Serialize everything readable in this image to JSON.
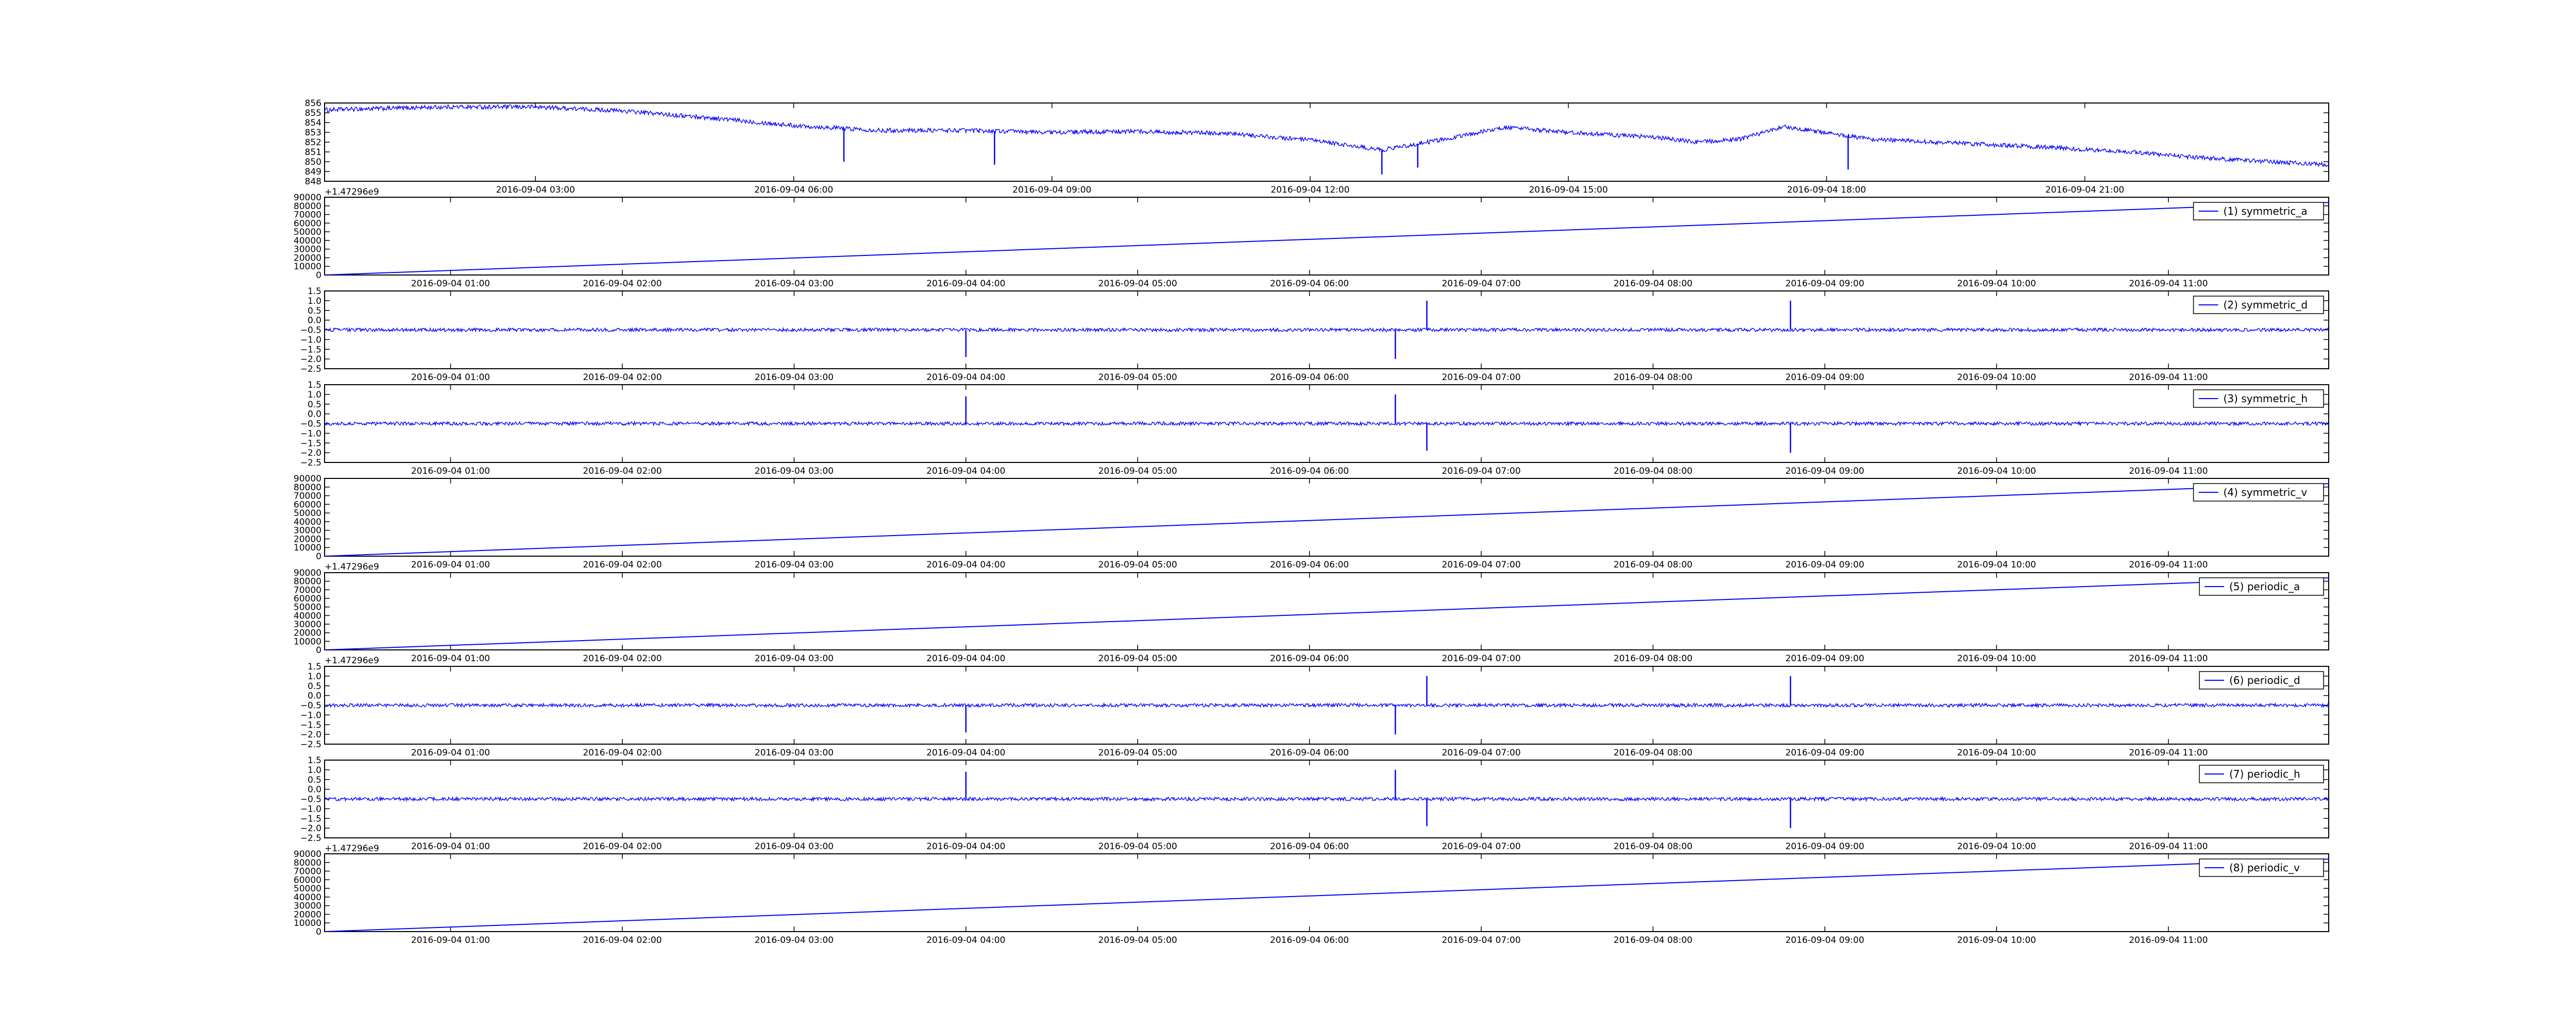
{
  "colors": {
    "line": "#0000ff",
    "axis": "#000000",
    "background": "#ffffff"
  },
  "chart_data": [
    {
      "type": "line",
      "title": "",
      "xlabel": "",
      "ylabel": "",
      "x_scale": "time",
      "xlim": [
        "2016-09-04 00:33",
        "2016-09-04 23:50"
      ],
      "ylim": [
        848,
        856
      ],
      "x_ticks": [
        "2016-09-04 03:00",
        "2016-09-04 06:00",
        "2016-09-04 09:00",
        "2016-09-04 12:00",
        "2016-09-04 15:00",
        "2016-09-04 18:00",
        "2016-09-04 21:00"
      ],
      "y_ticks": [
        848,
        849,
        850,
        851,
        852,
        853,
        854,
        855,
        856
      ],
      "offset_text": "+1.47296e9",
      "legend": null,
      "style": "noisy",
      "series": [
        {
          "x": [
            "2016-09-04 00:33",
            "2016-09-04 02:00",
            "2016-09-04 03:00",
            "2016-09-04 04:00",
            "2016-09-04 05:00",
            "2016-09-04 06:00",
            "2016-09-04 07:00",
            "2016-09-04 08:00",
            "2016-09-04 09:00",
            "2016-09-04 10:00",
            "2016-09-04 11:00",
            "2016-09-04 12:00",
            "2016-09-04 12:50",
            "2016-09-04 13:30",
            "2016-09-04 14:15",
            "2016-09-04 15:00",
            "2016-09-04 16:00",
            "2016-09-04 16:30",
            "2016-09-04 17:00",
            "2016-09-04 17:30",
            "2016-09-04 18:30",
            "2016-09-04 19:30",
            "2016-09-04 20:30",
            "2016-09-04 21:30",
            "2016-09-04 22:30",
            "2016-09-04 23:50"
          ],
          "values": [
            855.3,
            855.6,
            855.6,
            855.2,
            854.5,
            853.7,
            853.2,
            853.2,
            853.0,
            853.1,
            852.9,
            852.2,
            851.2,
            852.2,
            853.5,
            853.0,
            852.5,
            852.0,
            852.3,
            853.6,
            852.3,
            851.9,
            851.5,
            851.0,
            850.3,
            849.7
          ]
        }
      ],
      "spikes": [
        {
          "x": "2016-09-04 06:35",
          "y": 850.0
        },
        {
          "x": "2016-09-04 08:20",
          "y": 849.7
        },
        {
          "x": "2016-09-04 12:50",
          "y": 848.7
        },
        {
          "x": "2016-09-04 13:15",
          "y": 849.4
        },
        {
          "x": "2016-09-04 18:15",
          "y": 849.2
        }
      ]
    },
    {
      "type": "line",
      "title": "",
      "xlabel": "",
      "ylabel": "",
      "x_scale": "time",
      "xlim": [
        "2016-09-04 00:16",
        "2016-09-04 11:56"
      ],
      "ylim": [
        0,
        90000
      ],
      "x_ticks": [
        "2016-09-04 01:00",
        "2016-09-04 02:00",
        "2016-09-04 03:00",
        "2016-09-04 04:00",
        "2016-09-04 05:00",
        "2016-09-04 06:00",
        "2016-09-04 07:00",
        "2016-09-04 08:00",
        "2016-09-04 09:00",
        "2016-09-04 10:00",
        "2016-09-04 11:00"
      ],
      "y_ticks": [
        0,
        10000,
        20000,
        30000,
        40000,
        50000,
        60000,
        70000,
        80000,
        90000
      ],
      "offset_text": "",
      "legend": "top-right",
      "style": "smooth",
      "series": [
        {
          "name": "(1) symmetric_a",
          "x": [
            "2016-09-04 00:16",
            "2016-09-04 11:56"
          ],
          "values": [
            0,
            84000
          ]
        }
      ]
    },
    {
      "type": "line",
      "title": "",
      "xlabel": "",
      "ylabel": "",
      "x_scale": "time",
      "xlim": [
        "2016-09-04 00:16",
        "2016-09-04 11:56"
      ],
      "ylim": [
        -2.5,
        1.5
      ],
      "x_ticks": [
        "2016-09-04 01:00",
        "2016-09-04 02:00",
        "2016-09-04 03:00",
        "2016-09-04 04:00",
        "2016-09-04 05:00",
        "2016-09-04 06:00",
        "2016-09-04 07:00",
        "2016-09-04 08:00",
        "2016-09-04 09:00",
        "2016-09-04 10:00",
        "2016-09-04 11:00"
      ],
      "y_ticks": [
        -2.5,
        -2.0,
        -1.5,
        -1.0,
        -0.5,
        0.0,
        0.5,
        1.0,
        1.5
      ],
      "y_tick_labels": [
        "−2.5",
        "−2.0",
        "−1.5",
        "−1.0",
        "−0.5",
        "0.0",
        "0.5",
        "1.0",
        "1.5"
      ],
      "offset_text": "",
      "legend": "top-right",
      "style": "noisy",
      "series": [
        {
          "name": "(2) symmetric_d",
          "x": [
            "2016-09-04 00:16",
            "2016-09-04 11:56"
          ],
          "values": [
            -0.5,
            -0.5
          ]
        }
      ],
      "spikes": [
        {
          "x": "2016-09-04 04:00",
          "y": -1.9
        },
        {
          "x": "2016-09-04 06:30",
          "y": -2.0
        },
        {
          "x": "2016-09-04 06:41",
          "y": 1.0
        },
        {
          "x": "2016-09-04 08:48",
          "y": 1.0
        }
      ]
    },
    {
      "type": "line",
      "title": "",
      "xlabel": "",
      "ylabel": "",
      "x_scale": "time",
      "xlim": [
        "2016-09-04 00:16",
        "2016-09-04 11:56"
      ],
      "ylim": [
        -2.5,
        1.5
      ],
      "x_ticks": [
        "2016-09-04 01:00",
        "2016-09-04 02:00",
        "2016-09-04 03:00",
        "2016-09-04 04:00",
        "2016-09-04 05:00",
        "2016-09-04 06:00",
        "2016-09-04 07:00",
        "2016-09-04 08:00",
        "2016-09-04 09:00",
        "2016-09-04 10:00",
        "2016-09-04 11:00"
      ],
      "y_ticks": [
        -2.5,
        -2.0,
        -1.5,
        -1.0,
        -0.5,
        0.0,
        0.5,
        1.0,
        1.5
      ],
      "y_tick_labels": [
        "−2.5",
        "−2.0",
        "−1.5",
        "−1.0",
        "−0.5",
        "0.0",
        "0.5",
        "1.0",
        "1.5"
      ],
      "offset_text": "",
      "legend": "top-right",
      "style": "noisy",
      "series": [
        {
          "name": "(3) symmetric_h",
          "x": [
            "2016-09-04 00:16",
            "2016-09-04 11:56"
          ],
          "values": [
            -0.5,
            -0.5
          ]
        }
      ],
      "spikes": [
        {
          "x": "2016-09-04 04:00",
          "y": 0.9
        },
        {
          "x": "2016-09-04 06:30",
          "y": 1.0
        },
        {
          "x": "2016-09-04 06:41",
          "y": -1.9
        },
        {
          "x": "2016-09-04 08:48",
          "y": -2.0
        }
      ]
    },
    {
      "type": "line",
      "title": "",
      "xlabel": "",
      "ylabel": "",
      "x_scale": "time",
      "xlim": [
        "2016-09-04 00:16",
        "2016-09-04 11:56"
      ],
      "ylim": [
        0,
        90000
      ],
      "x_ticks": [
        "2016-09-04 01:00",
        "2016-09-04 02:00",
        "2016-09-04 03:00",
        "2016-09-04 04:00",
        "2016-09-04 05:00",
        "2016-09-04 06:00",
        "2016-09-04 07:00",
        "2016-09-04 08:00",
        "2016-09-04 09:00",
        "2016-09-04 10:00",
        "2016-09-04 11:00"
      ],
      "y_ticks": [
        0,
        10000,
        20000,
        30000,
        40000,
        50000,
        60000,
        70000,
        80000,
        90000
      ],
      "offset_text": "+1.47296e9",
      "legend": "top-right",
      "style": "smooth",
      "series": [
        {
          "name": "(4) symmetric_v",
          "x": [
            "2016-09-04 00:16",
            "2016-09-04 11:56"
          ],
          "values": [
            0,
            84000
          ]
        }
      ]
    },
    {
      "type": "line",
      "title": "",
      "xlabel": "",
      "ylabel": "",
      "x_scale": "time",
      "xlim": [
        "2016-09-04 00:16",
        "2016-09-04 11:56"
      ],
      "ylim": [
        0,
        90000
      ],
      "x_ticks": [
        "2016-09-04 01:00",
        "2016-09-04 02:00",
        "2016-09-04 03:00",
        "2016-09-04 04:00",
        "2016-09-04 05:00",
        "2016-09-04 06:00",
        "2016-09-04 07:00",
        "2016-09-04 08:00",
        "2016-09-04 09:00",
        "2016-09-04 10:00",
        "2016-09-04 11:00"
      ],
      "y_ticks": [
        0,
        10000,
        20000,
        30000,
        40000,
        50000,
        60000,
        70000,
        80000,
        90000
      ],
      "offset_text": "+1.47296e9",
      "legend": "top-right",
      "style": "smooth",
      "series": [
        {
          "name": "(5) periodic_a",
          "x": [
            "2016-09-04 00:16",
            "2016-09-04 11:56"
          ],
          "values": [
            0,
            84000
          ]
        }
      ]
    },
    {
      "type": "line",
      "title": "",
      "xlabel": "",
      "ylabel": "",
      "x_scale": "time",
      "xlim": [
        "2016-09-04 00:16",
        "2016-09-04 11:56"
      ],
      "ylim": [
        -2.5,
        1.5
      ],
      "x_ticks": [
        "2016-09-04 01:00",
        "2016-09-04 02:00",
        "2016-09-04 03:00",
        "2016-09-04 04:00",
        "2016-09-04 05:00",
        "2016-09-04 06:00",
        "2016-09-04 07:00",
        "2016-09-04 08:00",
        "2016-09-04 09:00",
        "2016-09-04 10:00",
        "2016-09-04 11:00"
      ],
      "y_ticks": [
        -2.5,
        -2.0,
        -1.5,
        -1.0,
        -0.5,
        0.0,
        0.5,
        1.0,
        1.5
      ],
      "y_tick_labels": [
        "−2.5",
        "−2.0",
        "−1.5",
        "−1.0",
        "−0.5",
        "0.0",
        "0.5",
        "1.0",
        "1.5"
      ],
      "offset_text": "",
      "legend": "top-right",
      "style": "noisy",
      "series": [
        {
          "name": "(6) periodic_d",
          "x": [
            "2016-09-04 00:16",
            "2016-09-04 11:56"
          ],
          "values": [
            -0.5,
            -0.5
          ]
        }
      ],
      "spikes": [
        {
          "x": "2016-09-04 04:00",
          "y": -1.9
        },
        {
          "x": "2016-09-04 06:30",
          "y": -2.0
        },
        {
          "x": "2016-09-04 06:41",
          "y": 1.0
        },
        {
          "x": "2016-09-04 08:48",
          "y": 1.0
        }
      ]
    },
    {
      "type": "line",
      "title": "",
      "xlabel": "",
      "ylabel": "",
      "x_scale": "time",
      "xlim": [
        "2016-09-04 00:16",
        "2016-09-04 11:56"
      ],
      "ylim": [
        -2.5,
        1.5
      ],
      "x_ticks": [
        "2016-09-04 01:00",
        "2016-09-04 02:00",
        "2016-09-04 03:00",
        "2016-09-04 04:00",
        "2016-09-04 05:00",
        "2016-09-04 06:00",
        "2016-09-04 07:00",
        "2016-09-04 08:00",
        "2016-09-04 09:00",
        "2016-09-04 10:00",
        "2016-09-04 11:00"
      ],
      "y_ticks": [
        -2.5,
        -2.0,
        -1.5,
        -1.0,
        -0.5,
        0.0,
        0.5,
        1.0,
        1.5
      ],
      "y_tick_labels": [
        "−2.5",
        "−2.0",
        "−1.5",
        "−1.0",
        "−0.5",
        "0.0",
        "0.5",
        "1.0",
        "1.5"
      ],
      "offset_text": "+1.47296e9",
      "legend": "top-right",
      "style": "noisy",
      "series": [
        {
          "name": "(7) periodic_h",
          "x": [
            "2016-09-04 00:16",
            "2016-09-04 11:56"
          ],
          "values": [
            -0.5,
            -0.5
          ]
        }
      ],
      "spikes": [
        {
          "x": "2016-09-04 04:00",
          "y": 0.9
        },
        {
          "x": "2016-09-04 06:30",
          "y": 1.0
        },
        {
          "x": "2016-09-04 06:41",
          "y": -1.9
        },
        {
          "x": "2016-09-04 08:48",
          "y": -2.0
        }
      ]
    },
    {
      "type": "line",
      "title": "",
      "xlabel": "",
      "ylabel": "",
      "x_scale": "time",
      "xlim": [
        "2016-09-04 00:16",
        "2016-09-04 11:56"
      ],
      "ylim": [
        0,
        90000
      ],
      "x_ticks": [
        "2016-09-04 01:00",
        "2016-09-04 02:00",
        "2016-09-04 03:00",
        "2016-09-04 04:00",
        "2016-09-04 05:00",
        "2016-09-04 06:00",
        "2016-09-04 07:00",
        "2016-09-04 08:00",
        "2016-09-04 09:00",
        "2016-09-04 10:00",
        "2016-09-04 11:00"
      ],
      "y_ticks": [
        0,
        10000,
        20000,
        30000,
        40000,
        50000,
        60000,
        70000,
        80000,
        90000
      ],
      "offset_text": "",
      "legend": "top-right",
      "style": "smooth",
      "series": [
        {
          "name": "(8) periodic_v",
          "x": [
            "2016-09-04 00:16",
            "2016-09-04 11:56"
          ],
          "values": [
            0,
            84000
          ]
        }
      ]
    }
  ]
}
